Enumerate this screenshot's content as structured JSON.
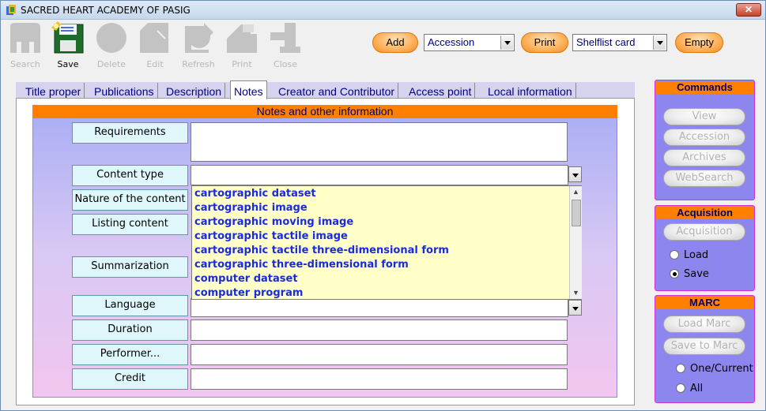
{
  "window": {
    "title": "SACRED HEART ACADEMY OF PASIG",
    "close_icon": "close-icon"
  },
  "toolbar": {
    "tools": [
      {
        "label": "Search",
        "icon": "search-icon",
        "enabled": false
      },
      {
        "label": "Save",
        "icon": "save-icon",
        "enabled": true
      },
      {
        "label": "Delete",
        "icon": "delete-icon",
        "enabled": false
      },
      {
        "label": "Edit",
        "icon": "edit-icon",
        "enabled": false
      },
      {
        "label": "Refresh",
        "icon": "refresh-icon",
        "enabled": false
      },
      {
        "label": "Print",
        "icon": "print-icon",
        "enabled": false
      },
      {
        "label": "Close",
        "icon": "close-tool-icon",
        "enabled": false
      }
    ],
    "add_label": "Add",
    "add_select": "Accession",
    "print_label": "Print",
    "print_select": "Shelflist card",
    "empty_label": "Empty"
  },
  "tabs": [
    {
      "label": "Title proper",
      "active": false
    },
    {
      "label": "Publications",
      "active": false
    },
    {
      "label": "Description",
      "active": false
    },
    {
      "label": "Notes",
      "active": true
    },
    {
      "label": "Creator and Contributor",
      "active": false
    },
    {
      "label": "Access point",
      "active": false
    },
    {
      "label": "Local information",
      "active": false
    }
  ],
  "notes": {
    "header": "Notes and other information",
    "fields": {
      "requirements": "Requirements",
      "content_type": "Content type",
      "nature": "Nature of the content",
      "listing": "Listing content",
      "summarization": "Summarization",
      "language": "Language",
      "duration": "Duration",
      "performer": "Performer...",
      "credit": "Credit"
    },
    "values": {
      "requirements": "",
      "content_type": "",
      "language": "",
      "duration": "",
      "performer": "",
      "credit": ""
    },
    "content_type_options": [
      "cartographic dataset",
      "cartographic image",
      "cartographic moving image",
      "cartographic tactile image",
      "cartographic tactile three-dimensional form",
      "cartographic three-dimensional form",
      "computer dataset",
      "computer program"
    ]
  },
  "commands": {
    "title": "Commands",
    "buttons": [
      "View",
      "Accession",
      "Archives",
      "WebSearch"
    ]
  },
  "acquisition": {
    "title": "Acquisition",
    "button": "Acquisition",
    "options": [
      {
        "label": "Load",
        "selected": false
      },
      {
        "label": "Save",
        "selected": true
      }
    ]
  },
  "marc": {
    "title": "MARC",
    "buttons": [
      "Load Marc",
      "Save to Marc"
    ],
    "options": [
      {
        "label": "One/Current",
        "selected": false
      },
      {
        "label": "All",
        "selected": false
      }
    ]
  },
  "colors": {
    "accent_orange": "#ff7f00",
    "panel_purple": "#8d86ee",
    "link_blue": "#1a2bd8",
    "field_label_bg": "#dff7fb"
  }
}
